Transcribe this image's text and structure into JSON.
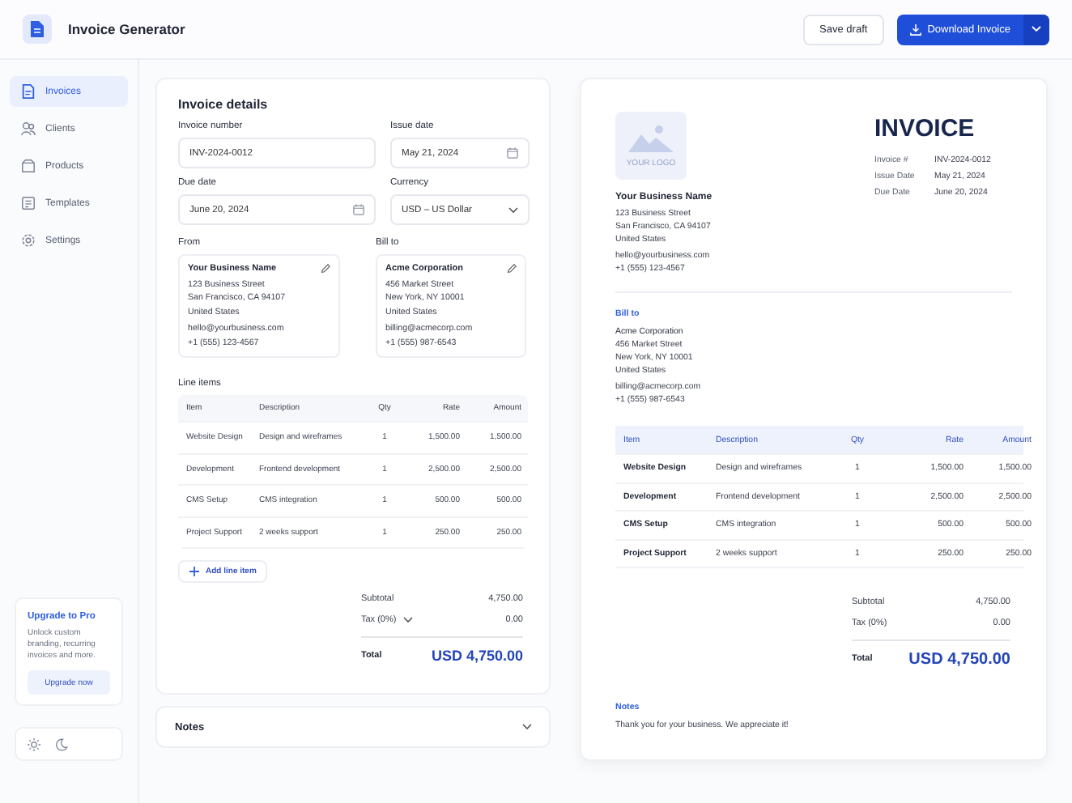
{
  "header": {
    "title": "Invoice Generator",
    "save_button": "Save draft",
    "download_button": "Download Invoice"
  },
  "sidebar": {
    "items": [
      {
        "label": "Invoices",
        "kind": "doc",
        "selected": true
      },
      {
        "label": "Clients",
        "kind": "people",
        "selected": false
      },
      {
        "label": "Products",
        "kind": "box",
        "selected": false
      },
      {
        "label": "Templates",
        "kind": "template",
        "selected": false
      },
      {
        "label": "Settings",
        "kind": "gear",
        "selected": false
      }
    ],
    "upgrade": {
      "title": "Upgrade to Pro",
      "text": "Unlock custom branding, recurring invoices and more.",
      "button": "Upgrade now"
    }
  },
  "editor": {
    "title": "Invoice details",
    "fields": [
      {
        "label": "Invoice number",
        "value": "INV-2024-0012",
        "kind": "text"
      },
      {
        "label": "Issue date",
        "value": "May 21, 2024",
        "kind": "date"
      },
      {
        "label": "Due date",
        "value": "June 20, 2024",
        "kind": "date"
      },
      {
        "label": "Currency",
        "value": "USD – US Dollar",
        "kind": "select"
      }
    ],
    "parties": [
      {
        "label": "From",
        "name": "Your Business Name",
        "lines": [
          "123 Business Street",
          "San Francisco, CA 94107",
          "United States"
        ],
        "email": "hello@yourbusiness.com",
        "phone": "+1 (555) 123-4567"
      },
      {
        "label": "Bill to",
        "name": "Acme Corporation",
        "lines": [
          "456 Market Street",
          "New York, NY 10001",
          "United States"
        ],
        "email": "billing@acmecorp.com",
        "phone": "+1 (555) 987-6543"
      }
    ],
    "line_items": {
      "label": "Line items",
      "columns": [
        "Item",
        "Description",
        "Qty",
        "Rate",
        "Amount"
      ],
      "rows": [
        [
          "Website Design",
          "Design and wireframes",
          "1",
          "1,500.00",
          "1,500.00"
        ],
        [
          "Development",
          "Frontend development",
          "1",
          "2,500.00",
          "2,500.00"
        ],
        [
          "CMS Setup",
          "CMS integration",
          "1",
          "500.00",
          "500.00"
        ],
        [
          "Project Support",
          "2 weeks support",
          "1",
          "250.00",
          "250.00"
        ]
      ],
      "add_button": "Add line item"
    },
    "totals": {
      "subtotal_label": "Subtotal",
      "subtotal": "4,750.00",
      "tax_label": "Tax (0%)",
      "tax": "0.00",
      "total_label": "Total",
      "total": "USD 4,750.00"
    }
  },
  "notes": {
    "label": "Notes",
    "expanded": false
  },
  "preview": {
    "logo_text": "YOUR LOGO",
    "title": "INVOICE",
    "business": {
      "name": "Your Business Name",
      "lines": [
        "123 Business Street",
        "San Francisco, CA 94107",
        "United States"
      ],
      "email": "hello@yourbusiness.com",
      "phone": "+1 (555) 123-4567"
    },
    "meta": [
      {
        "label": "Invoice #",
        "value": "INV-2024-0012"
      },
      {
        "label": "Issue Date",
        "value": "May 21, 2024"
      },
      {
        "label": "Due Date",
        "value": "June 20, 2024"
      }
    ],
    "bill_to": {
      "label": "Bill to",
      "name": "Acme Corporation",
      "lines": [
        "456 Market Street",
        "New York, NY 10001",
        "United States"
      ],
      "email": "billing@acmecorp.com",
      "phone": "+1 (555) 987-6543"
    },
    "columns": [
      "Item",
      "Description",
      "Qty",
      "Rate",
      "Amount"
    ],
    "rows": [
      [
        "Website Design",
        "Design and wireframes",
        "1",
        "1,500.00",
        "1,500.00"
      ],
      [
        "Development",
        "Frontend development",
        "1",
        "2,500.00",
        "2,500.00"
      ],
      [
        "CMS Setup",
        "CMS integration",
        "1",
        "500.00",
        "500.00"
      ],
      [
        "Project Support",
        "2 weeks support",
        "1",
        "250.00",
        "250.00"
      ]
    ],
    "totals": {
      "subtotal_label": "Subtotal",
      "subtotal": "4,750.00",
      "tax_label": "Tax (0%)",
      "tax": "0.00",
      "total_label": "Total",
      "total": "USD 4,750.00"
    },
    "notes_label": "Notes",
    "notes_text": "Thank you for your business. We appreciate it!"
  }
}
